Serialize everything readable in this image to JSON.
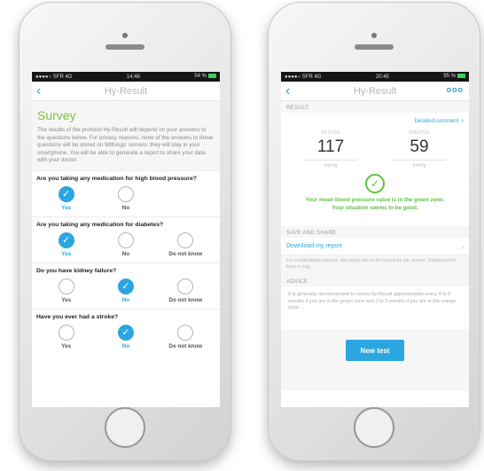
{
  "left": {
    "status": {
      "carrier": "●●●●○ SFR 4G",
      "time": "14:46",
      "battery": "54 %"
    },
    "nav": {
      "back": "‹",
      "title": "Hy-Result"
    },
    "survey": {
      "title": "Survey",
      "intro": "The results of the protocol Hy-Result will depend on your answers to the questions below. For privacy reasons, none of the answers to these questions will be stored on Withings' servers: they will stay in your smartphone. You will be able to generate a report to share your data with your doctor.",
      "questions": [
        {
          "text": "Are you taking any medication for high blood pressure?",
          "opts": [
            "Yes",
            "No"
          ]
        },
        {
          "text": "Are you taking any medication for diabetes?",
          "opts": [
            "Yes",
            "No",
            "Do not know"
          ]
        },
        {
          "text": "Do you have kidney failure?",
          "opts": [
            "Yes",
            "No",
            "Do not know"
          ]
        },
        {
          "text": "Have you ever had a stroke?",
          "opts": [
            "Yes",
            "No",
            "Do not know"
          ]
        }
      ]
    }
  },
  "right": {
    "status": {
      "carrier": "●●●●○ SFR 4G",
      "time": "20:45",
      "battery": "95 %"
    },
    "nav": {
      "back": "‹",
      "title": "Hy-Result",
      "more": "ooo"
    },
    "result": {
      "section": "RESULT",
      "detailed": "Detailed comment",
      "systol_label": "SYSTOL",
      "diastol_label": "DIASTOL",
      "systol_value": "117",
      "diastol_value": "59",
      "unit": "mmHg",
      "verdict_1": "Your mean blood pressure value is in the green zone.",
      "verdict_2": "Your situation seems to be good."
    },
    "share": {
      "section": "SAVE AND SHARE",
      "download": "Download my report",
      "note": "For confidentiality reasons, this report will not be hosted on our servers. Download it to keep a copy."
    },
    "advice": {
      "section": "ADVICE",
      "text": "It is generally recommended to renew Hy-Result approximately every 4 to 6 months if you are in the green zone and 2 to 3 months if you are in the orange zone ..."
    },
    "button": "New test"
  },
  "colors": {
    "accent": "#2ba6e1",
    "green": "#5cc43f",
    "survey_title": "#7fc241"
  }
}
